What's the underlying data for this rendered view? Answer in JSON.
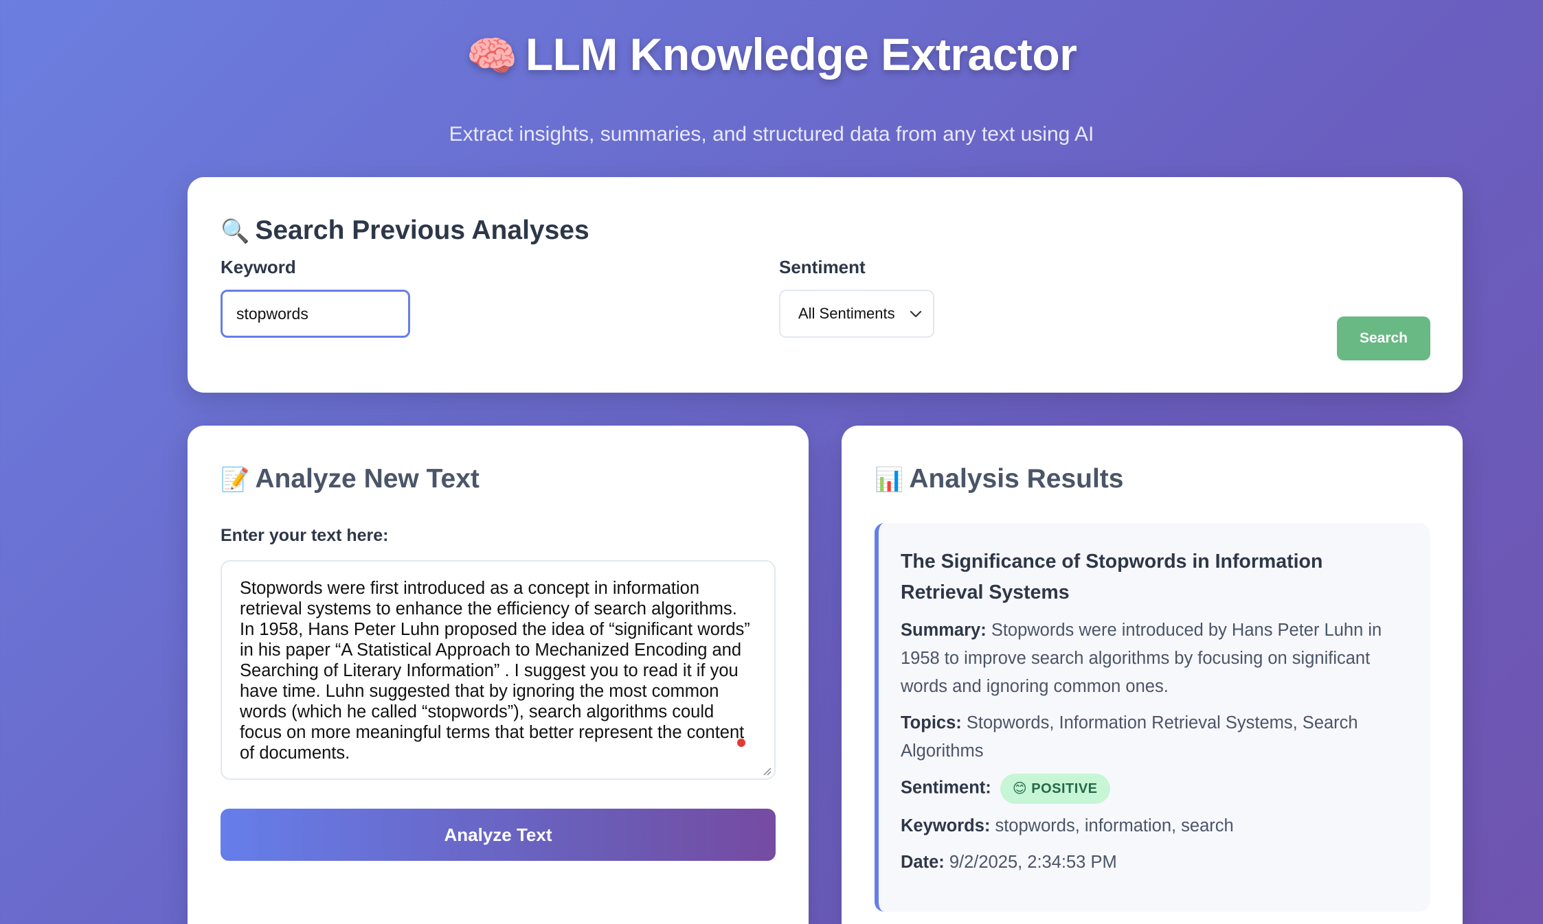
{
  "header": {
    "emoji": "🧠",
    "title": "LLM Knowledge Extractor",
    "subtitle": "Extract insights, summaries, and structured data from any text using AI"
  },
  "search": {
    "emoji": "🔍",
    "title": "Search Previous Analyses",
    "keyword_label": "Keyword",
    "keyword_value": "stopwords",
    "sentiment_label": "Sentiment",
    "sentiment_value": "All Sentiments",
    "button_label": "Search"
  },
  "analyze": {
    "emoji": "📝",
    "title": "Analyze New Text",
    "input_label": "Enter your text here:",
    "text": "Stopwords were first introduced as a concept in information retrieval systems to enhance the efficiency of search algorithms. In 1958, Hans Peter Luhn proposed the idea of “significant words” in his paper “A Statistical Approach to Mechanized Encoding and Searching of Literary Information” . I suggest you to read it if you have time. Luhn suggested that by ignoring the most common words (which he called “stopwords”), search algorithms could focus on more meaningful terms that better represent the content of documents.",
    "button_label": "Analyze Text"
  },
  "results": {
    "emoji": "📊",
    "title": "Analysis Results",
    "item": {
      "title": "The Significance of Stopwords in Information Retrieval Systems",
      "summary_label": "Summary:",
      "summary": "Stopwords were introduced by Hans Peter Luhn in 1958 to improve search algorithms by focusing on significant words and ignoring common ones.",
      "topics_label": "Topics:",
      "topics": "Stopwords, Information Retrieval Systems, Search Algorithms",
      "sentiment_label": "Sentiment:",
      "sentiment": "😊 POSITIVE",
      "keywords_label": "Keywords:",
      "keywords": "stopwords, information, search",
      "date_label": "Date:",
      "date": "9/2/2025, 2:34:53 PM"
    }
  },
  "colors": {
    "accent": "#667eea",
    "search_button": "#68b984",
    "positive_badge_bg": "#c6f6d5",
    "positive_badge_text": "#276749"
  }
}
